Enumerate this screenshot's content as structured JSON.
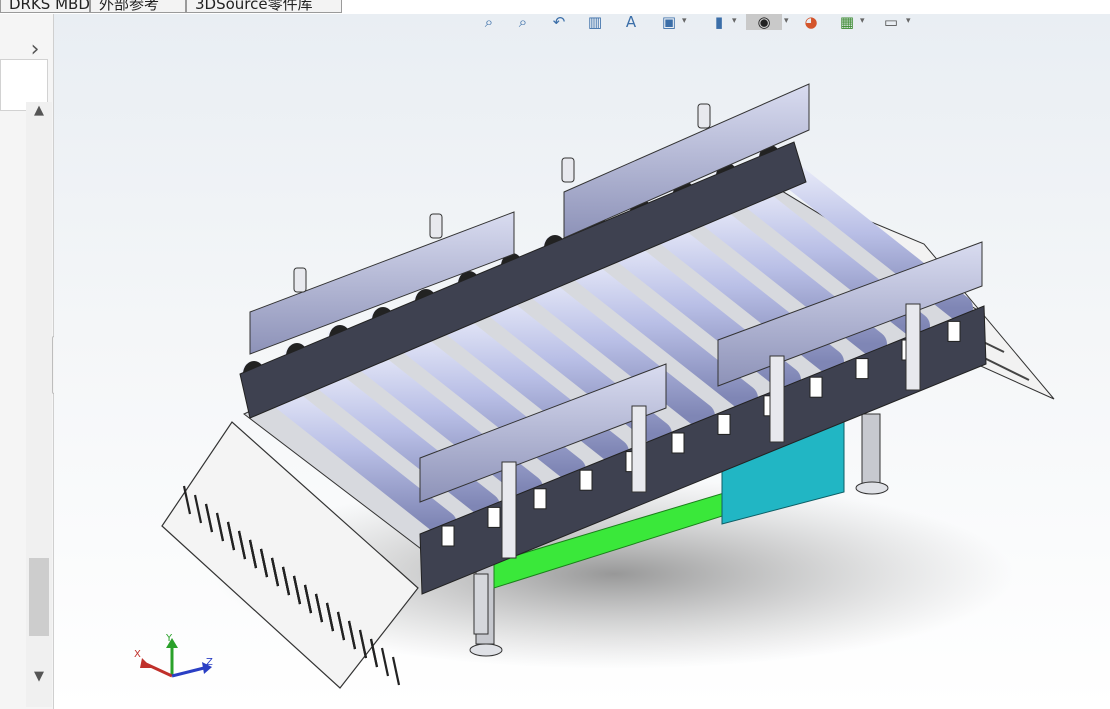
{
  "tabs": [
    {
      "label": "DRKS MBD"
    },
    {
      "label": "外部参考"
    },
    {
      "label": "3DSource零件库"
    }
  ],
  "left_panel": {
    "expand_label": "›",
    "scroll_up": "▲",
    "scroll_down": "▼"
  },
  "hud_toolbar": {
    "icons": [
      "zoom-to-fit-icon",
      "zoom-to-area-icon",
      "previous-view-icon",
      "section-view-icon",
      "dynamic-annotation-icon",
      "view-orientation-icon",
      "display-style-icon",
      "hide-show-items-icon",
      "edit-appearance-icon",
      "apply-scene-icon",
      "view-settings-icon"
    ]
  },
  "triad": {
    "x_label": "X",
    "y_label": "Y",
    "z_label": "Z"
  },
  "colors": {
    "roller": "#b9bfe6",
    "side_plate": "#3e4150",
    "frame_green": "#3ae83a",
    "control_box": "#21b6c4",
    "guard_panel": "#a9aed3",
    "vent_plate": "#f4f4f4"
  }
}
